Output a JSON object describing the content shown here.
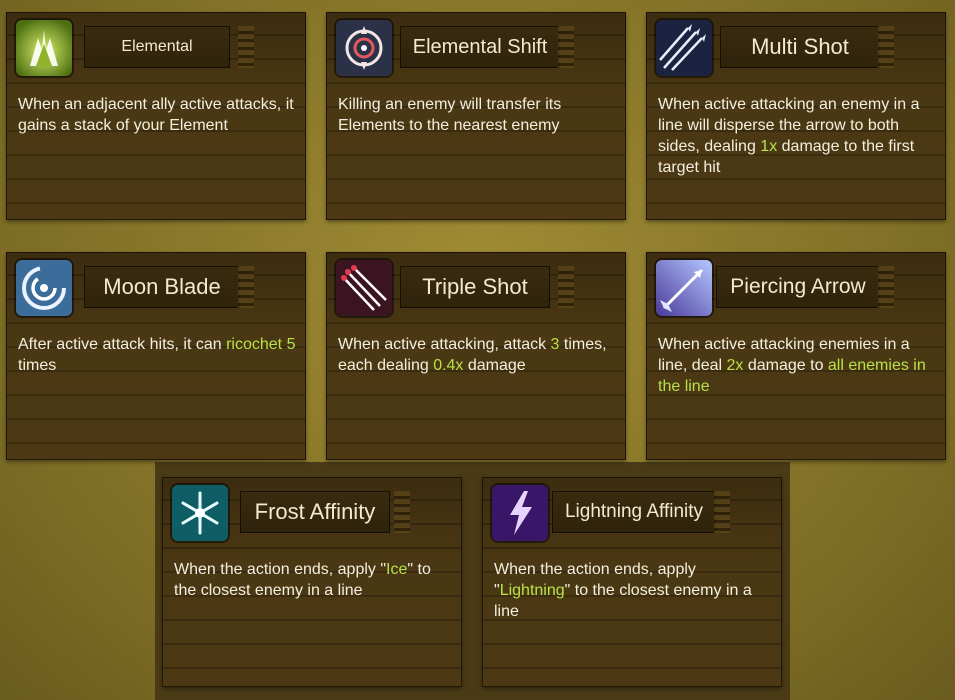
{
  "cards": [
    {
      "title": "Elemental",
      "icon": "elemental-hand-icon",
      "desc": [
        {
          "t": "When an adjacent ally active attacks, it gains a stack of your Element"
        }
      ]
    },
    {
      "title": "Elemental Shift",
      "icon": "elemental-shift-swirl-icon",
      "desc": [
        {
          "t": "Killing an enemy will transfer its Elements to the nearest enemy"
        }
      ]
    },
    {
      "title": "Multi Shot",
      "icon": "multi-arrow-icon",
      "desc": [
        {
          "t": "When active attacking an enemy in a line will disperse the arrow to both sides, dealing "
        },
        {
          "t": "1x",
          "hl": true
        },
        {
          "t": " damage to the first target hit"
        }
      ]
    },
    {
      "title": "Moon Blade",
      "icon": "moon-spiral-icon",
      "desc": [
        {
          "t": "After active attack hits, it can "
        },
        {
          "t": "ricochet 5",
          "hl": true
        },
        {
          "t": " times"
        }
      ]
    },
    {
      "title": "Triple Shot",
      "icon": "triple-arrow-icon",
      "desc": [
        {
          "t": "When active attacking, attack "
        },
        {
          "t": "3",
          "hl": true
        },
        {
          "t": " times, each dealing "
        },
        {
          "t": "0.4x",
          "hl": true
        },
        {
          "t": " damage"
        }
      ]
    },
    {
      "title": "Piercing Arrow",
      "icon": "piercing-arrow-icon",
      "desc": [
        {
          "t": "When active attacking enemies in a line, deal "
        },
        {
          "t": "2x",
          "hl": true
        },
        {
          "t": " damage to "
        },
        {
          "t": "all enemies in the line",
          "hl": true
        }
      ]
    },
    {
      "title": "Frost Affinity",
      "icon": "snowflake-icon",
      "desc": [
        {
          "t": "When the action ends, apply \""
        },
        {
          "t": "Ice",
          "hl": true
        },
        {
          "t": "\" to the closest enemy in a line"
        }
      ]
    },
    {
      "title": "Lightning Affinity",
      "icon": "lightning-bolt-icon",
      "desc": [
        {
          "t": "When the action ends, apply \""
        },
        {
          "t": "Lightning",
          "hl": true
        },
        {
          "t": "\" to the closest enemy in a line"
        }
      ]
    }
  ],
  "colors": {
    "highlight": "#b7e24a",
    "text": "#f4efe0",
    "title": "#f3ead2"
  }
}
